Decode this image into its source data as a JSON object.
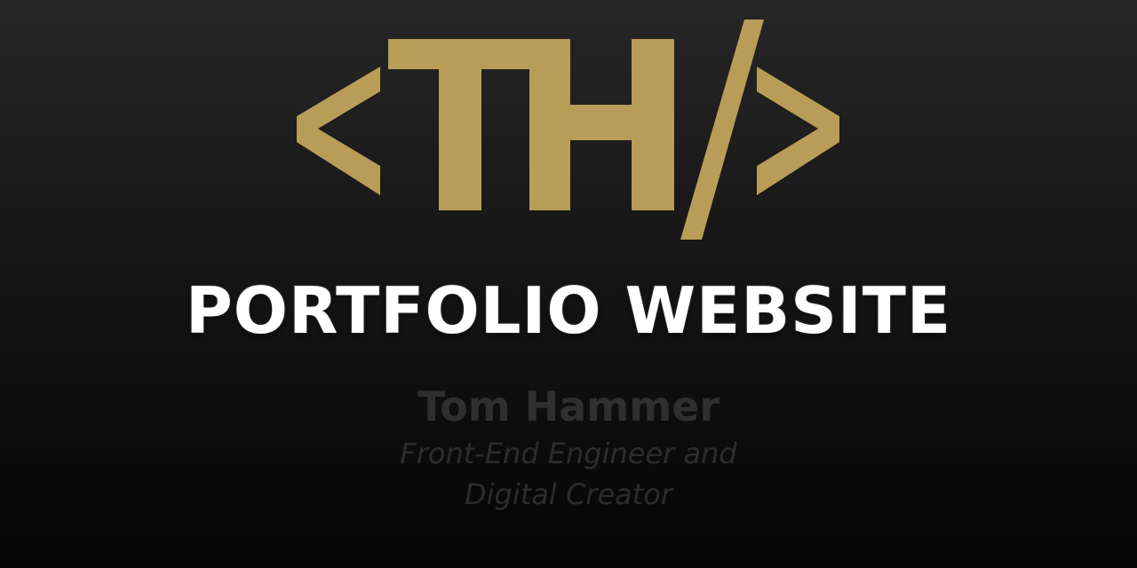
{
  "logo": {
    "text": "<TH/>",
    "icon": "th-code-brackets-logo",
    "color": "#b89c57"
  },
  "title": "PORTFOLIO WEBSITE",
  "name": "Tom Hammer",
  "tagline": {
    "line1": "Front-End Engineer and",
    "line2": "Digital Creator"
  },
  "colors": {
    "accent": "#b89c57",
    "title": "#ffffff",
    "muted": "#2f2f2f",
    "background_top": "#262626",
    "background_bottom": "#050505"
  }
}
